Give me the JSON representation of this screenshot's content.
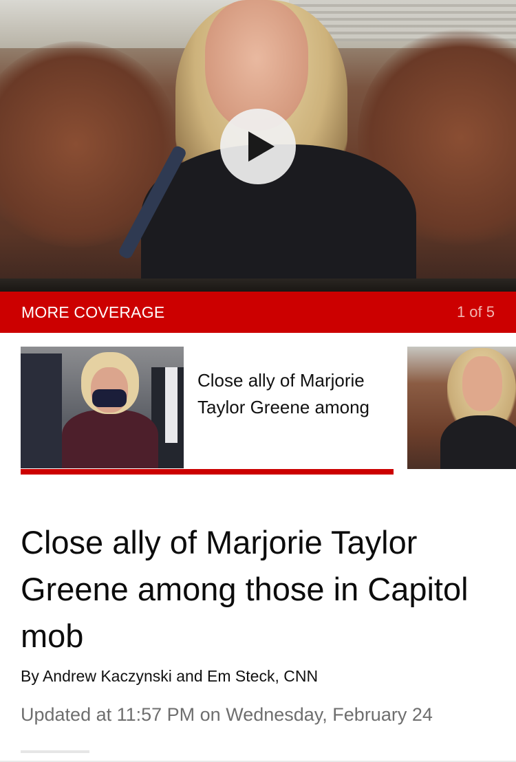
{
  "hero": {
    "play_icon": "play-icon"
  },
  "coverage": {
    "label": "MORE COVERAGE",
    "count": "1 of 5",
    "accent": "#cc0000"
  },
  "carousel": {
    "active_card": {
      "title": "Close ally of Marjorie Taylor Greene among"
    }
  },
  "article": {
    "headline": "Close ally of Marjorie Taylor Greene among those in Capitol mob",
    "byline": "By Andrew Kaczynski and Em Steck, CNN",
    "updated": "Updated at 11:57 PM on Wednesday, February 24"
  }
}
